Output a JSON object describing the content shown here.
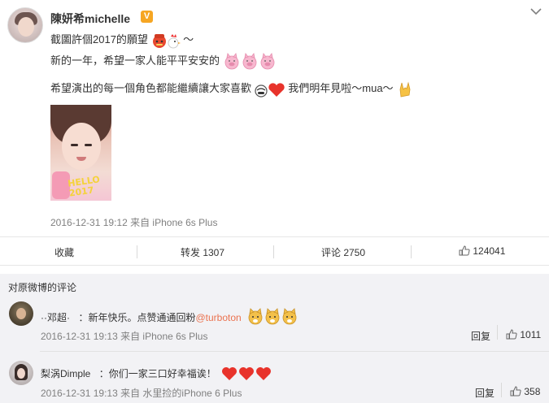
{
  "post": {
    "author": "陳妍希michelle",
    "verified_badge": "V",
    "line1": "截圖許個2017的願望",
    "line1_tail": "～",
    "line2": "新的一年，希望一家人能平平安安的",
    "line3a": "希望演出的每一個角色都能繼續讓大家喜歡",
    "line3b": "我們明年見啦～mua～",
    "photo_text": "HELLO 2017",
    "timestamp": "2016-12-31 19:12",
    "source": "来自 iPhone 6s Plus"
  },
  "actions": {
    "favorite": "收藏",
    "repost": "转发 1307",
    "comment": "评论 2750",
    "like": "124041"
  },
  "comments_section": {
    "title": "对原微博的评论",
    "items": [
      {
        "name": "··邓超·",
        "text": "：新年快乐。点赞通通回粉",
        "mention": "@turboton",
        "timestamp": "2016-12-31 19:13",
        "source": "来自 iPhone 6s Plus",
        "reply": "回复",
        "likes": "1011"
      },
      {
        "name": "梨涡Dimple",
        "text": "：你们一家三口好幸福诶！",
        "timestamp": "2016-12-31 19:13",
        "source": "来自 水里捡的iPhone 6 Plus",
        "reply": "回复",
        "likes": "358"
      }
    ]
  },
  "colors": {
    "badge": "#f6a623",
    "mention": "#eb7350",
    "meta": "#808080",
    "section_bg": "#f2f2f5"
  },
  "icons": [
    "chevron-down-icon",
    "thumbs-up-icon",
    "verified-v-icon",
    "emoji-icons"
  ]
}
